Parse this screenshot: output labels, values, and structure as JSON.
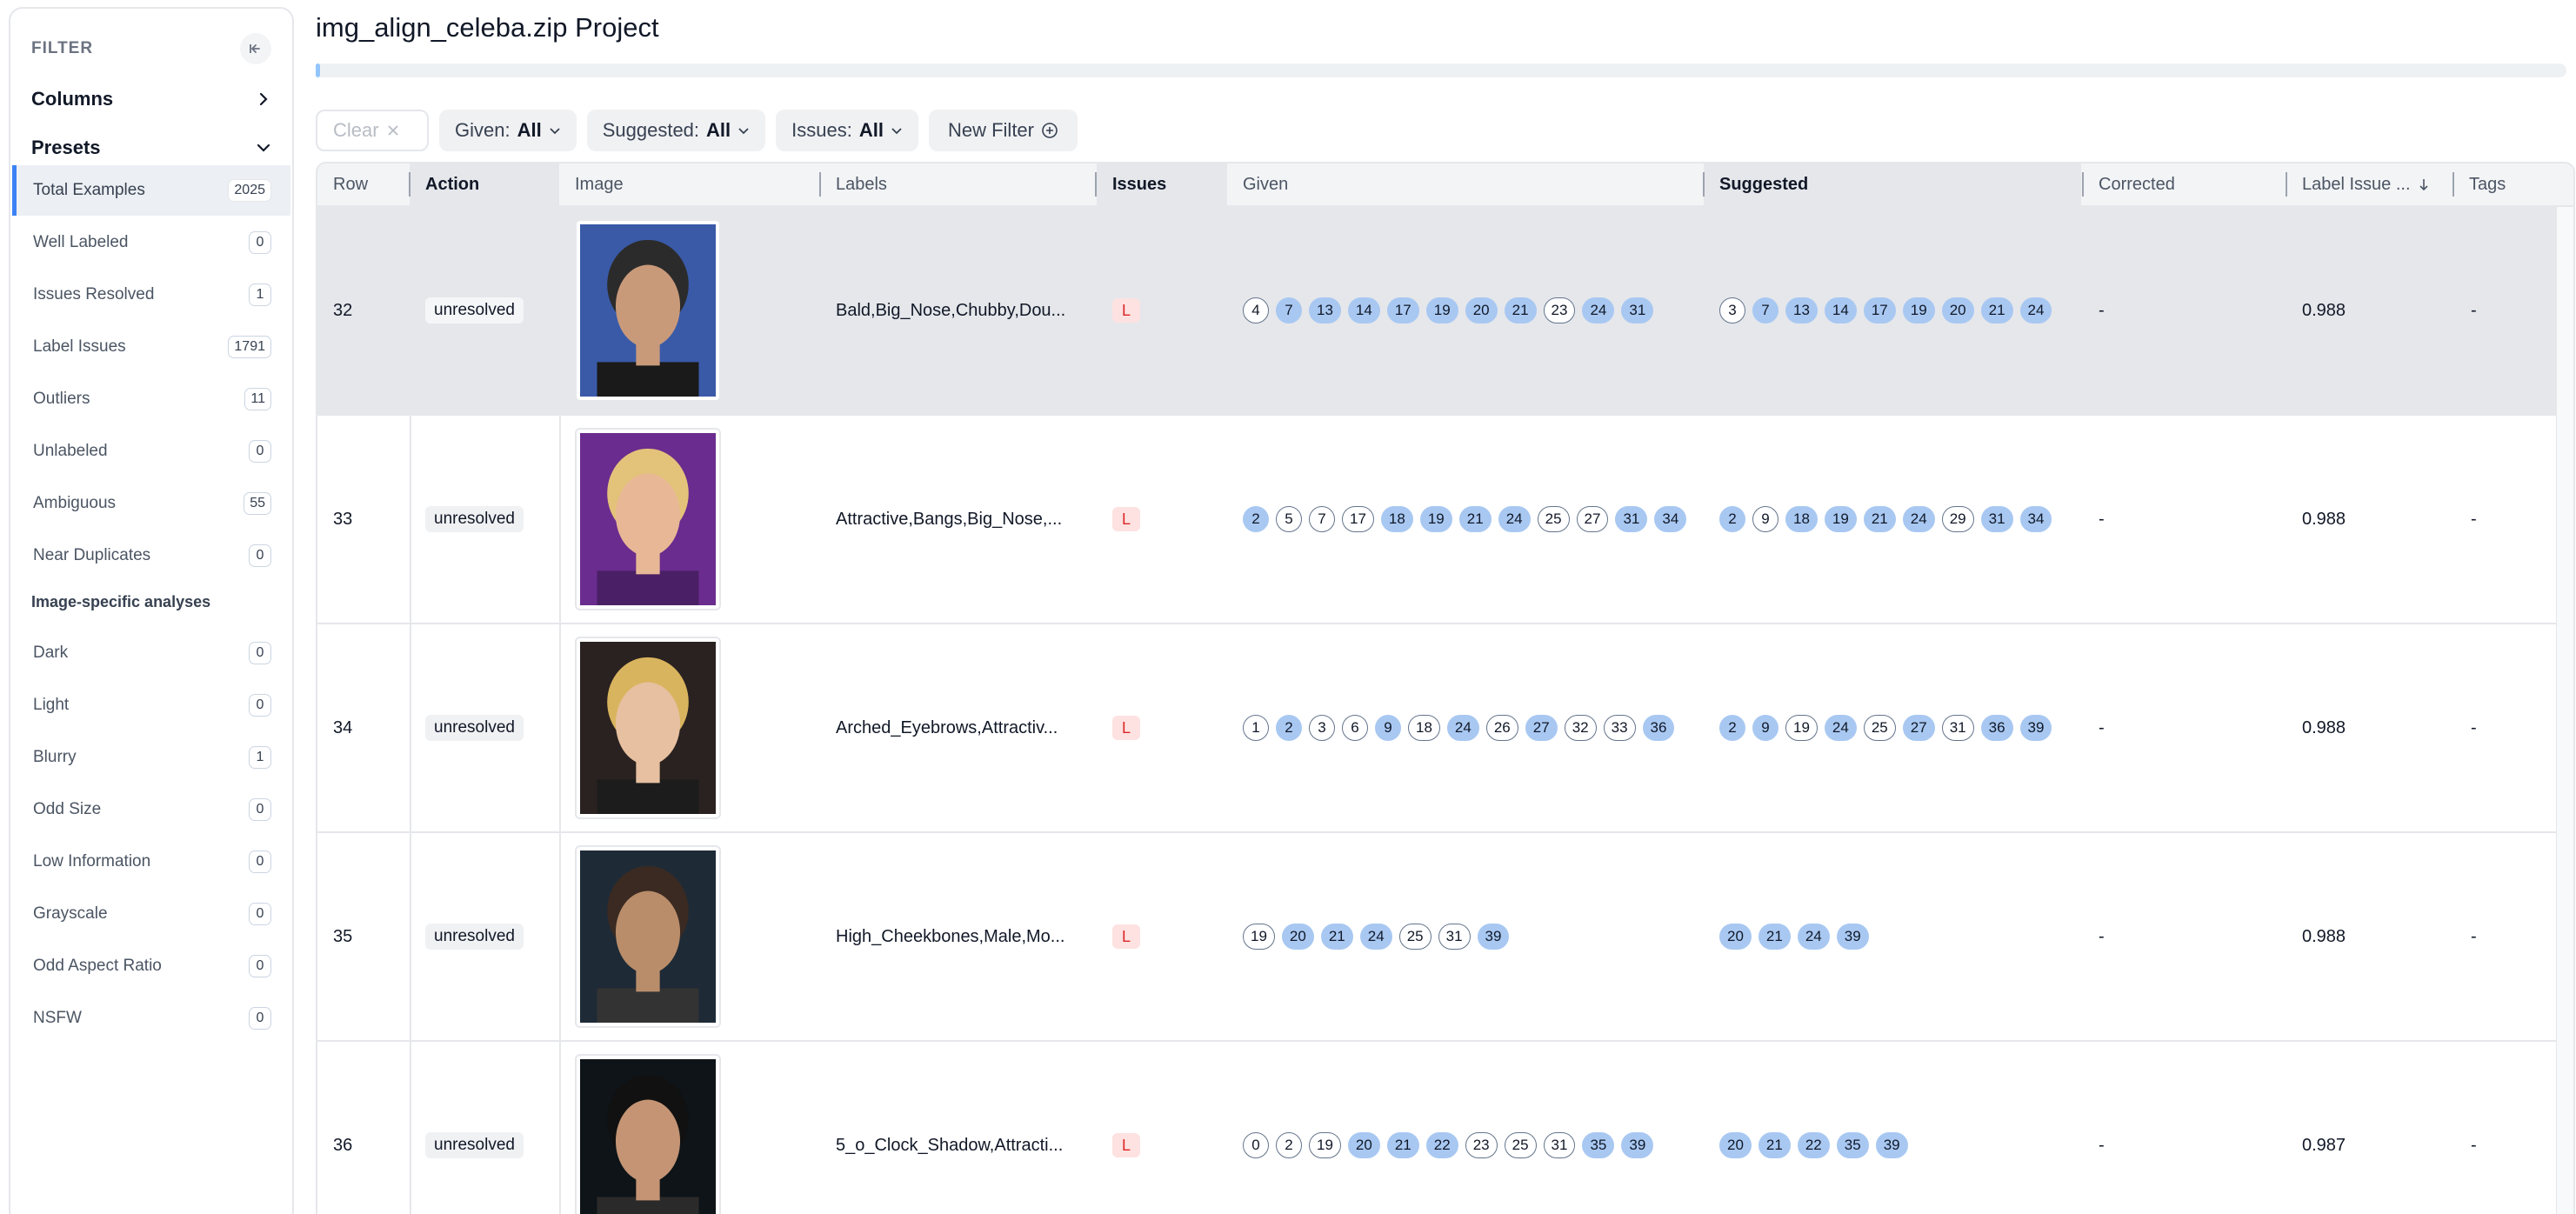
{
  "sidebar": {
    "filter_title": "FILTER",
    "columns_label": "Columns",
    "presets_label": "Presets",
    "items": [
      {
        "label": "Total Examples",
        "count": "2025"
      },
      {
        "label": "Well Labeled",
        "count": "0"
      },
      {
        "label": "Issues Resolved",
        "count": "1"
      },
      {
        "label": "Label Issues",
        "count": "1791"
      },
      {
        "label": "Outliers",
        "count": "11"
      },
      {
        "label": "Unlabeled",
        "count": "0"
      },
      {
        "label": "Ambiguous",
        "count": "55"
      },
      {
        "label": "Near Duplicates",
        "count": "0"
      }
    ],
    "image_section_title": "Image-specific analyses",
    "image_items": [
      {
        "label": "Dark",
        "count": "0"
      },
      {
        "label": "Light",
        "count": "0"
      },
      {
        "label": "Blurry",
        "count": "1"
      },
      {
        "label": "Odd Size",
        "count": "0"
      },
      {
        "label": "Low Information",
        "count": "0"
      },
      {
        "label": "Grayscale",
        "count": "0"
      },
      {
        "label": "Odd Aspect Ratio",
        "count": "0"
      },
      {
        "label": "NSFW",
        "count": "0"
      }
    ]
  },
  "header": {
    "title": "img_align_celeba.zip Project",
    "progress": 0.002
  },
  "toolbar": {
    "clear_label": "Clear",
    "given_label": "Given:",
    "given_value": "All",
    "suggested_label": "Suggested:",
    "suggested_value": "All",
    "issues_label": "Issues:",
    "issues_value": "All",
    "new_filter_label": "New Filter"
  },
  "table": {
    "columns": [
      "Row",
      "Action",
      "Image",
      "Labels",
      "Issues",
      "Given",
      "Suggested",
      "Corrected",
      "Label Issue ...",
      "Tags"
    ],
    "rows": [
      {
        "row": "32",
        "action": "unresolved",
        "labels": "Bald,Big_Nose,Chubby,Dou...",
        "issue": "L",
        "given": [
          [
            "4",
            0
          ],
          [
            "7",
            1
          ],
          [
            "13",
            1
          ],
          [
            "14",
            1
          ],
          [
            "17",
            1
          ],
          [
            "19",
            1
          ],
          [
            "20",
            1
          ],
          [
            "21",
            1
          ],
          [
            "23",
            0
          ],
          [
            "24",
            1
          ],
          [
            "31",
            1
          ]
        ],
        "suggested": [
          [
            "3",
            0
          ],
          [
            "7",
            1
          ],
          [
            "13",
            1
          ],
          [
            "14",
            1
          ],
          [
            "17",
            1
          ],
          [
            "19",
            1
          ],
          [
            "20",
            1
          ],
          [
            "21",
            1
          ],
          [
            "24",
            1
          ]
        ],
        "corrected": "-",
        "score": "0.988",
        "tags": "-"
      },
      {
        "row": "33",
        "action": "unresolved",
        "labels": "Attractive,Bangs,Big_Nose,...",
        "issue": "L",
        "given": [
          [
            "2",
            1
          ],
          [
            "5",
            0
          ],
          [
            "7",
            0
          ],
          [
            "17",
            0
          ],
          [
            "18",
            1
          ],
          [
            "19",
            1
          ],
          [
            "21",
            1
          ],
          [
            "24",
            1
          ],
          [
            "25",
            0
          ],
          [
            "27",
            0
          ],
          [
            "31",
            1
          ],
          [
            "34",
            1
          ]
        ],
        "suggested": [
          [
            "2",
            1
          ],
          [
            "9",
            0
          ],
          [
            "18",
            1
          ],
          [
            "19",
            1
          ],
          [
            "21",
            1
          ],
          [
            "24",
            1
          ],
          [
            "29",
            0
          ],
          [
            "31",
            1
          ],
          [
            "34",
            1
          ]
        ],
        "corrected": "-",
        "score": "0.988",
        "tags": "-"
      },
      {
        "row": "34",
        "action": "unresolved",
        "labels": "Arched_Eyebrows,Attractiv...",
        "issue": "L",
        "given": [
          [
            "1",
            0
          ],
          [
            "2",
            1
          ],
          [
            "3",
            0
          ],
          [
            "6",
            0
          ],
          [
            "9",
            1
          ],
          [
            "18",
            0
          ],
          [
            "24",
            1
          ],
          [
            "26",
            0
          ],
          [
            "27",
            1
          ],
          [
            "32",
            0
          ],
          [
            "33",
            0
          ],
          [
            "36",
            1
          ]
        ],
        "suggested": [
          [
            "2",
            1
          ],
          [
            "9",
            1
          ],
          [
            "19",
            0
          ],
          [
            "24",
            1
          ],
          [
            "25",
            0
          ],
          [
            "27",
            1
          ],
          [
            "31",
            0
          ],
          [
            "36",
            1
          ],
          [
            "39",
            1
          ]
        ],
        "corrected": "-",
        "score": "0.988",
        "tags": "-"
      },
      {
        "row": "35",
        "action": "unresolved",
        "labels": "High_Cheekbones,Male,Mo...",
        "issue": "L",
        "given": [
          [
            "19",
            0
          ],
          [
            "20",
            1
          ],
          [
            "21",
            1
          ],
          [
            "24",
            1
          ],
          [
            "25",
            0
          ],
          [
            "31",
            0
          ],
          [
            "39",
            1
          ]
        ],
        "suggested": [
          [
            "20",
            1
          ],
          [
            "21",
            1
          ],
          [
            "24",
            1
          ],
          [
            "39",
            1
          ]
        ],
        "corrected": "-",
        "score": "0.988",
        "tags": "-"
      },
      {
        "row": "36",
        "action": "unresolved",
        "labels": "5_o_Clock_Shadow,Attracti...",
        "issue": "L",
        "given": [
          [
            "0",
            0
          ],
          [
            "2",
            0
          ],
          [
            "19",
            0
          ],
          [
            "20",
            1
          ],
          [
            "21",
            1
          ],
          [
            "22",
            1
          ],
          [
            "23",
            0
          ],
          [
            "25",
            0
          ],
          [
            "31",
            0
          ],
          [
            "35",
            1
          ],
          [
            "39",
            1
          ]
        ],
        "suggested": [
          [
            "20",
            1
          ],
          [
            "21",
            1
          ],
          [
            "22",
            1
          ],
          [
            "35",
            1
          ],
          [
            "39",
            1
          ]
        ],
        "corrected": "-",
        "score": "0.987",
        "tags": "-"
      }
    ]
  },
  "colors": {
    "accent": "#3b82f6",
    "chip_blue": "#a8c8f2",
    "issue_red": "#dc2626"
  },
  "icons": [
    "arrow-left-icon",
    "chevron-right-icon",
    "chevron-down-icon",
    "close-icon",
    "plus-circle-icon",
    "arrow-down-icon"
  ]
}
